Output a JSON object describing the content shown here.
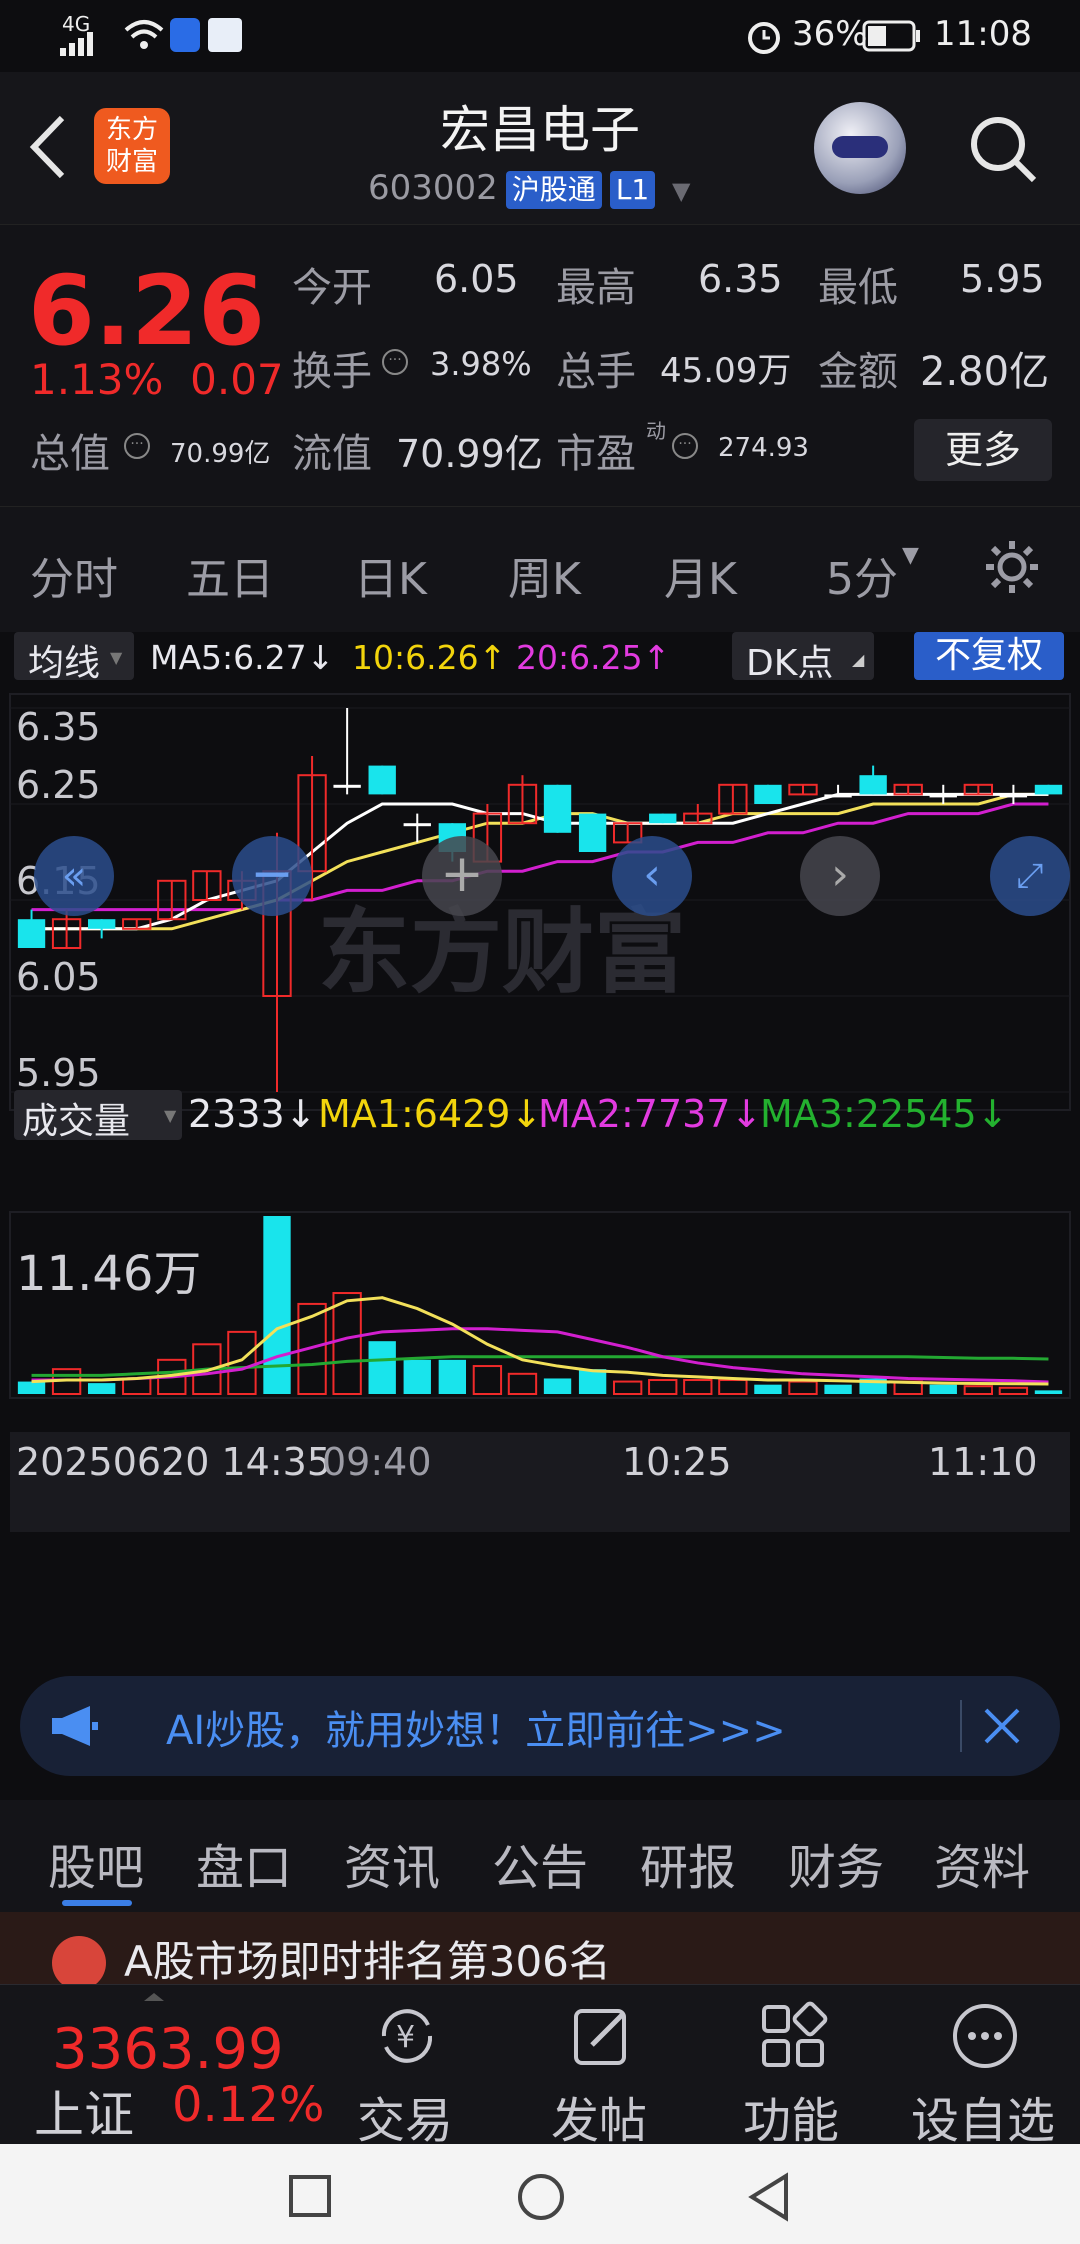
{
  "status_bar": {
    "signal": "4G",
    "battery": "36%",
    "time": "11:08"
  },
  "header": {
    "title": "宏昌电子",
    "code": "603002",
    "market_tag": "沪股通",
    "level_tag": "L1",
    "logo_line1": "东方",
    "logo_line2": "财富"
  },
  "quote": {
    "price": "6.26",
    "change_pct": "1.13%",
    "change": "0.07",
    "open_label": "今开",
    "open": "6.05",
    "high_label": "最高",
    "high": "6.35",
    "low_label": "最低",
    "low": "5.95",
    "turnover_label": "换手",
    "turnover": "3.98%",
    "volume_label": "总手",
    "volume": "45.09万",
    "amount_label": "金额",
    "amount": "2.80亿",
    "mktcap_label": "总值",
    "mktcap": "70.99亿",
    "float_label": "流值",
    "float": "70.99亿",
    "pe_label": "市盈",
    "pe_sup": "动",
    "pe": "274.93",
    "more": "更多"
  },
  "periods": [
    "分时",
    "五日",
    "日K",
    "周K",
    "月K",
    "5分"
  ],
  "kline_header": {
    "indicator": "均线",
    "ma5": "MA5:6.27↓",
    "ma10": "10:6.26↑",
    "ma20": "20:6.25↑",
    "dk": "DK点",
    "adjust": "不复权"
  },
  "volume_header": {
    "indicator": "成交量",
    "vol": "2333↓",
    "ma1": "MA1:6429↓",
    "ma2": "MA2:7737↓",
    "ma3": "MA3:22545↓"
  },
  "volume_axis_max": "11.46万",
  "x_labels": [
    "20250620 14:35",
    "09:40",
    "10:25",
    "11:10"
  ],
  "watermark": "东方财富",
  "chart_data": {
    "type": "candlestick",
    "y_ticks": [
      "6.35",
      "6.25",
      "6.15",
      "6.05",
      "5.95"
    ],
    "ylim": [
      5.95,
      6.35
    ],
    "candles": [
      {
        "o": 6.13,
        "c": 6.1,
        "h": 6.14,
        "l": 6.1,
        "up": false
      },
      {
        "o": 6.1,
        "c": 6.13,
        "h": 6.14,
        "l": 6.1,
        "up": true
      },
      {
        "o": 6.13,
        "c": 6.12,
        "h": 6.13,
        "l": 6.11,
        "up": false
      },
      {
        "o": 6.12,
        "c": 6.13,
        "h": 6.13,
        "l": 6.12,
        "up": true
      },
      {
        "o": 6.13,
        "c": 6.17,
        "h": 6.17,
        "l": 6.13,
        "up": true
      },
      {
        "o": 6.15,
        "c": 6.18,
        "h": 6.18,
        "l": 6.15,
        "up": true
      },
      {
        "o": 6.15,
        "c": 6.17,
        "h": 6.18,
        "l": 6.14,
        "up": true
      },
      {
        "o": 6.05,
        "c": 6.18,
        "h": 6.22,
        "l": 5.95,
        "up": true
      },
      {
        "o": 6.18,
        "c": 6.28,
        "h": 6.3,
        "l": 6.15,
        "up": true
      },
      {
        "o": 6.27,
        "c": 6.27,
        "h": 6.35,
        "l": 6.26,
        "up": false
      },
      {
        "o": 6.29,
        "c": 6.26,
        "h": 6.29,
        "l": 6.26,
        "up": false
      },
      {
        "o": 6.23,
        "c": 6.23,
        "h": 6.24,
        "l": 6.21,
        "up": false
      },
      {
        "o": 6.23,
        "c": 6.2,
        "h": 6.23,
        "l": 6.19,
        "up": false
      },
      {
        "o": 6.19,
        "c": 6.24,
        "h": 6.25,
        "l": 6.19,
        "up": true
      },
      {
        "o": 6.23,
        "c": 6.27,
        "h": 6.28,
        "l": 6.23,
        "up": true
      },
      {
        "o": 6.27,
        "c": 6.22,
        "h": 6.27,
        "l": 6.22,
        "up": false
      },
      {
        "o": 6.24,
        "c": 6.2,
        "h": 6.24,
        "l": 6.2,
        "up": false
      },
      {
        "o": 6.21,
        "c": 6.23,
        "h": 6.23,
        "l": 6.21,
        "up": true
      },
      {
        "o": 6.24,
        "c": 6.23,
        "h": 6.24,
        "l": 6.23,
        "up": false
      },
      {
        "o": 6.23,
        "c": 6.24,
        "h": 6.25,
        "l": 6.23,
        "up": true
      },
      {
        "o": 6.24,
        "c": 6.27,
        "h": 6.27,
        "l": 6.24,
        "up": true
      },
      {
        "o": 6.27,
        "c": 6.25,
        "h": 6.27,
        "l": 6.25,
        "up": false
      },
      {
        "o": 6.26,
        "c": 6.27,
        "h": 6.27,
        "l": 6.26,
        "up": true
      },
      {
        "o": 6.26,
        "c": 6.26,
        "h": 6.27,
        "l": 6.26,
        "up": false
      },
      {
        "o": 6.28,
        "c": 6.26,
        "h": 6.29,
        "l": 6.26,
        "up": false
      },
      {
        "o": 6.26,
        "c": 6.27,
        "h": 6.27,
        "l": 6.26,
        "up": true
      },
      {
        "o": 6.26,
        "c": 6.26,
        "h": 6.27,
        "l": 6.25,
        "up": false
      },
      {
        "o": 6.26,
        "c": 6.27,
        "h": 6.27,
        "l": 6.26,
        "up": true
      },
      {
        "o": 6.26,
        "c": 6.26,
        "h": 6.27,
        "l": 6.25,
        "up": false
      },
      {
        "o": 6.27,
        "c": 6.26,
        "h": 6.27,
        "l": 6.26,
        "up": false
      }
    ],
    "ma5": [
      6.12,
      6.12,
      6.12,
      6.12,
      6.13,
      6.15,
      6.16,
      6.17,
      6.2,
      6.23,
      6.25,
      6.25,
      6.25,
      6.24,
      6.24,
      6.23,
      6.23,
      6.23,
      6.23,
      6.23,
      6.23,
      6.24,
      6.25,
      6.26,
      6.26,
      6.26,
      6.26,
      6.26,
      6.26,
      6.26
    ],
    "ma10": [
      6.12,
      6.12,
      6.12,
      6.12,
      6.12,
      6.13,
      6.14,
      6.15,
      6.17,
      6.19,
      6.2,
      6.21,
      6.22,
      6.23,
      6.23,
      6.24,
      6.24,
      6.23,
      6.23,
      6.23,
      6.24,
      6.24,
      6.24,
      6.24,
      6.25,
      6.25,
      6.25,
      6.25,
      6.26,
      6.26
    ],
    "ma20": [
      6.14,
      6.14,
      6.14,
      6.14,
      6.14,
      6.14,
      6.14,
      6.15,
      6.15,
      6.16,
      6.16,
      6.17,
      6.17,
      6.18,
      6.18,
      6.19,
      6.19,
      6.2,
      6.2,
      6.21,
      6.21,
      6.22,
      6.22,
      6.23,
      6.23,
      6.24,
      6.24,
      6.24,
      6.25,
      6.25
    ],
    "volume": {
      "ylim": [
        0,
        114600
      ],
      "bars": [
        {
          "v": 8000,
          "up": false
        },
        {
          "v": 16000,
          "up": true
        },
        {
          "v": 7000,
          "up": false
        },
        {
          "v": 10000,
          "up": true
        },
        {
          "v": 22000,
          "up": true
        },
        {
          "v": 32000,
          "up": true
        },
        {
          "v": 40000,
          "up": true
        },
        {
          "v": 114600,
          "up": false
        },
        {
          "v": 58000,
          "up": true
        },
        {
          "v": 65000,
          "up": true
        },
        {
          "v": 34000,
          "up": false
        },
        {
          "v": 22000,
          "up": false
        },
        {
          "v": 22000,
          "up": false
        },
        {
          "v": 18000,
          "up": true
        },
        {
          "v": 13000,
          "up": true
        },
        {
          "v": 10000,
          "up": false
        },
        {
          "v": 16000,
          "up": false
        },
        {
          "v": 8000,
          "up": true
        },
        {
          "v": 9000,
          "up": true
        },
        {
          "v": 9000,
          "up": true
        },
        {
          "v": 9000,
          "up": true
        },
        {
          "v": 6000,
          "up": false
        },
        {
          "v": 8000,
          "up": true
        },
        {
          "v": 6000,
          "up": false
        },
        {
          "v": 10000,
          "up": false
        },
        {
          "v": 8000,
          "up": true
        },
        {
          "v": 6000,
          "up": false
        },
        {
          "v": 5000,
          "up": true
        },
        {
          "v": 4000,
          "up": true
        },
        {
          "v": 2333,
          "up": false
        }
      ],
      "ma1": [
        8000,
        9000,
        9000,
        10000,
        12000,
        15000,
        22000,
        42000,
        50000,
        60000,
        62000,
        55000,
        45000,
        32000,
        22000,
        18000,
        15000,
        14000,
        12000,
        11000,
        10000,
        9000,
        9000,
        8500,
        8000,
        7500,
        7000,
        6800,
        6600,
        6429
      ],
      "ma2": [
        9000,
        9000,
        9000,
        10000,
        11000,
        13000,
        16000,
        24000,
        30000,
        36000,
        40000,
        41000,
        42000,
        42000,
        41000,
        40000,
        35000,
        30000,
        24000,
        20000,
        17000,
        15000,
        13000,
        12000,
        11000,
        10000,
        9500,
        9000,
        8500,
        7737
      ],
      "ma3": [
        12000,
        12000,
        12000,
        13000,
        14000,
        16000,
        17000,
        18000,
        19000,
        21000,
        22000,
        23000,
        24000,
        24000,
        24000,
        24000,
        24000,
        24000,
        24000,
        24000,
        24000,
        24000,
        24000,
        24000,
        24000,
        24000,
        23500,
        23000,
        23000,
        22545
      ]
    }
  },
  "banner": {
    "text": "AI炒股，就用妙想！立即前往>>>"
  },
  "info_tabs": [
    "股吧",
    "盘口",
    "资讯",
    "公告",
    "研报",
    "财务",
    "资料"
  ],
  "news": {
    "text": "A股市场即时排名第306名"
  },
  "bottom_nav": {
    "index_value": "3363.99",
    "index_name": "上证",
    "index_change": "0.12%",
    "items": [
      "交易",
      "发帖",
      "功能",
      "设自选"
    ]
  },
  "colors": {
    "up": "#f02a2a",
    "down_fill": "#19e4ec",
    "ma5": "#ffffff",
    "ma10": "#f2e05a",
    "ma20": "#d21fcf",
    "vol_ma3": "#23a832",
    "accent": "#3b7ee6"
  }
}
